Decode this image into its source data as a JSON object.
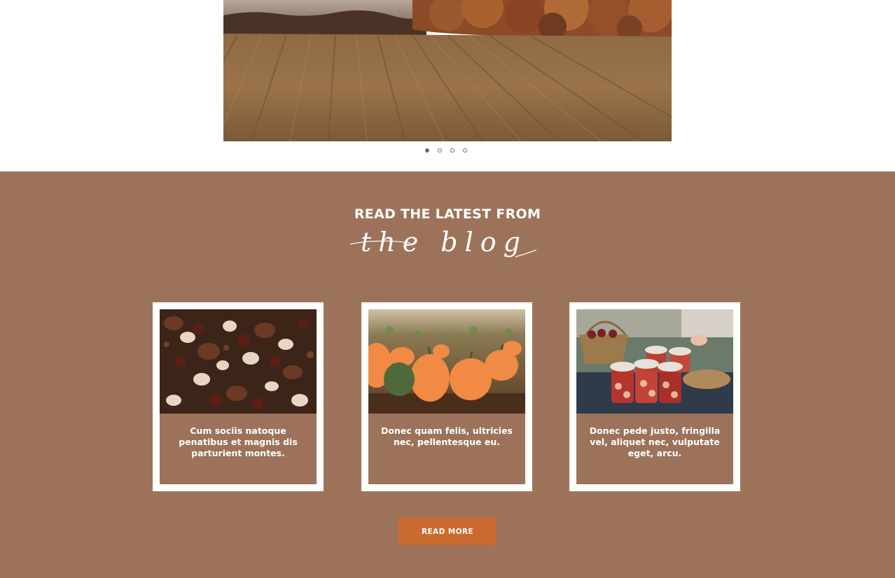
{
  "slider": {
    "image_alt": "Harvested autumn field with orange trees",
    "dots": [
      {
        "label": "slide-1",
        "active": true
      },
      {
        "label": "slide-2",
        "active": false
      },
      {
        "label": "slide-3",
        "active": false
      },
      {
        "label": "slide-4",
        "active": false
      }
    ]
  },
  "blog": {
    "heading": "READ THE LATEST FROM",
    "script_heading": "the blog",
    "posts": [
      {
        "title": "Cum sociis natoque penatibus et magnis dis parturient montes.",
        "image": "chestnuts-photo"
      },
      {
        "title": "Donec quam felis, ultricies nec, pellentesque eu.",
        "image": "pumpkins-photo"
      },
      {
        "title": "Donec pede justo, fringilla vel, aliquet nec, vulputate eget, arcu.",
        "image": "jam-jars-photo"
      }
    ],
    "read_more_label": "READ MORE"
  },
  "colors": {
    "section_bg": "#9c735a",
    "button_bg": "#cb6a2e",
    "card_border": "#ffffff"
  }
}
